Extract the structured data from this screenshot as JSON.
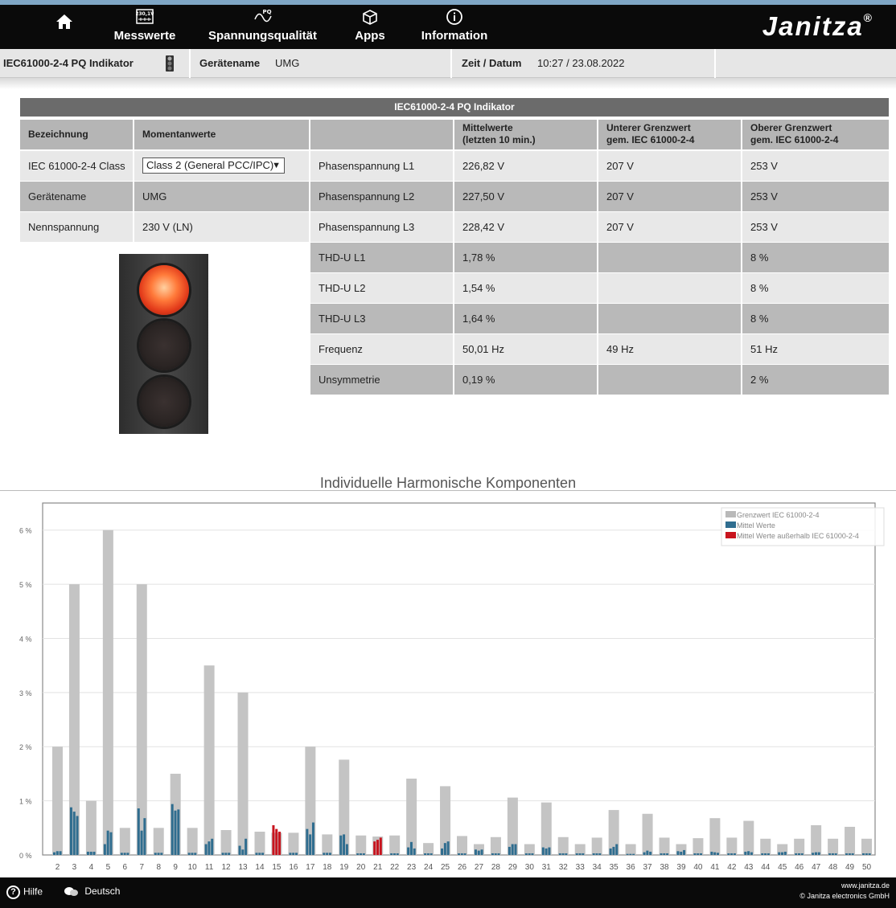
{
  "nav": {
    "home_icon": "home-icon",
    "items": [
      {
        "label": "Messwerte",
        "icon": "measurements-icon",
        "glyph": "230,1V"
      },
      {
        "label": "Spannungsqualität",
        "icon": "pq-wave-icon",
        "glyph": "PQ"
      },
      {
        "label": "Apps",
        "icon": "apps-box-icon",
        "glyph": "⬡"
      },
      {
        "label": "Information",
        "icon": "info-icon",
        "glyph": "ⓘ"
      }
    ],
    "brand": "Janitza",
    "brand_mark": "®"
  },
  "status": {
    "page": "IEC61000-2-4 PQ Indikator",
    "device_label": "Gerätename",
    "device_value": "UMG",
    "time_label": "Zeit / Datum",
    "time_value": "10:27 / 23.08.2022"
  },
  "table": {
    "title": "IEC61000-2-4 PQ Indikator",
    "headers": {
      "name": "Bezeichnung",
      "momentary": "Momentanwerte",
      "mean_1": "Mittelwerte",
      "mean_2": "(letzten 10 min.)",
      "lower_1": "Unterer Grenzwert",
      "lower_2": "gem. IEC 61000-2-4",
      "upper_1": "Oberer Grenzwert",
      "upper_2": "gem. IEC 61000-2-4"
    },
    "left_rows": [
      {
        "label": "IEC 61000-2-4 Class",
        "value": "Class 2 (General PCC/IPC)"
      },
      {
        "label": "Gerätename",
        "value": "UMG"
      },
      {
        "label": "Nennspannung",
        "value": "230 V (LN)"
      }
    ],
    "right_rows": [
      {
        "name": "Phasenspannung L1",
        "mean": "226,82 V",
        "lower": "207 V",
        "upper": "253 V"
      },
      {
        "name": "Phasenspannung L2",
        "mean": "227,50 V",
        "lower": "207 V",
        "upper": "253 V"
      },
      {
        "name": "Phasenspannung L3",
        "mean": "228,42 V",
        "lower": "207 V",
        "upper": "253 V"
      },
      {
        "name": "THD-U L1",
        "mean": "1,78 %",
        "lower": "",
        "upper": "8 %"
      },
      {
        "name": "THD-U L2",
        "mean": "1,54 %",
        "lower": "",
        "upper": "8 %"
      },
      {
        "name": "THD-U L3",
        "mean": "1,64 %",
        "lower": "",
        "upper": "8 %"
      },
      {
        "name": "Frequenz",
        "mean": "50,01 Hz",
        "lower": "49 Hz",
        "upper": "51 Hz"
      },
      {
        "name": "Unsymmetrie",
        "mean": "0,19 %",
        "lower": "",
        "upper": "2 %"
      }
    ],
    "traffic_light_state": "red"
  },
  "chart_data": {
    "type": "bar",
    "title": "Individuelle Harmonische Komponenten",
    "ylim": [
      0,
      6.5
    ],
    "yticks": [
      "0 %",
      "1 %",
      "2 %",
      "3 %",
      "4 %",
      "5 %",
      "6 %"
    ],
    "categories": [
      "2",
      "3",
      "4",
      "5",
      "6",
      "7",
      "8",
      "9",
      "10",
      "11",
      "12",
      "13",
      "14",
      "15",
      "16",
      "17",
      "18",
      "19",
      "20",
      "21",
      "22",
      "23",
      "24",
      "25",
      "26",
      "27",
      "28",
      "29",
      "30",
      "31",
      "32",
      "33",
      "34",
      "35",
      "36",
      "37",
      "38",
      "39",
      "40",
      "41",
      "42",
      "43",
      "44",
      "45",
      "46",
      "47",
      "48",
      "49",
      "50"
    ],
    "legend": [
      {
        "name": "Grenzwert IEC 61000-2-4",
        "color": "#b9b9b9"
      },
      {
        "name": "Mittel Werte",
        "color": "#2f6d8f"
      },
      {
        "name": "Mittel Werte außerhalb IEC 61000-2-4",
        "color": "#c8141e"
      }
    ],
    "legend_position": "top-right",
    "series": [
      {
        "name": "Grenzwert IEC 61000-2-4",
        "values": [
          2,
          5,
          1,
          6,
          0.5,
          5,
          0.5,
          1.5,
          0.5,
          3.5,
          0.46,
          3,
          0.43,
          0.41,
          0.41,
          2,
          0.38,
          1.76,
          0.36,
          0.34,
          0.36,
          1.41,
          0.22,
          1.27,
          0.35,
          0.2,
          0.33,
          1.06,
          0.2,
          0.97,
          0.33,
          0.2,
          0.32,
          0.83,
          0.2,
          0.76,
          0.32,
          0.2,
          0.31,
          0.68,
          0.32,
          0.63,
          0.3,
          0.2,
          0.3,
          0.55,
          0.3,
          0.52,
          0.3
        ]
      },
      {
        "name": "Mittel Werte L1",
        "values": [
          0.05,
          0.88,
          0.06,
          0.2,
          0.04,
          0.86,
          0.04,
          0.94,
          0.04,
          0.2,
          0.04,
          0.17,
          0.04,
          0.55,
          0.04,
          0.48,
          0.04,
          0.36,
          0.03,
          0.25,
          0.03,
          0.14,
          0.03,
          0.12,
          0.03,
          0.1,
          0.03,
          0.15,
          0.03,
          0.14,
          0.03,
          0.03,
          0.03,
          0.12,
          0.02,
          0.05,
          0.03,
          0.07,
          0.03,
          0.06,
          0.03,
          0.06,
          0.03,
          0.05,
          0.03,
          0.04,
          0.03,
          0.03,
          0.03
        ]
      },
      {
        "name": "Mittel Werte L2",
        "values": [
          0.07,
          0.8,
          0.06,
          0.45,
          0.04,
          0.45,
          0.04,
          0.82,
          0.04,
          0.25,
          0.04,
          0.1,
          0.04,
          0.48,
          0.04,
          0.38,
          0.04,
          0.38,
          0.03,
          0.28,
          0.03,
          0.24,
          0.03,
          0.22,
          0.03,
          0.08,
          0.03,
          0.2,
          0.03,
          0.12,
          0.03,
          0.03,
          0.03,
          0.15,
          0.02,
          0.08,
          0.03,
          0.06,
          0.03,
          0.05,
          0.03,
          0.07,
          0.03,
          0.05,
          0.03,
          0.05,
          0.03,
          0.03,
          0.03
        ]
      },
      {
        "name": "Mittel Werte L3",
        "values": [
          0.07,
          0.72,
          0.06,
          0.42,
          0.04,
          0.68,
          0.04,
          0.84,
          0.04,
          0.3,
          0.04,
          0.3,
          0.04,
          0.43,
          0.04,
          0.6,
          0.04,
          0.2,
          0.03,
          0.32,
          0.03,
          0.12,
          0.03,
          0.25,
          0.03,
          0.1,
          0.03,
          0.2,
          0.03,
          0.14,
          0.03,
          0.03,
          0.03,
          0.2,
          0.02,
          0.06,
          0.03,
          0.09,
          0.03,
          0.04,
          0.03,
          0.05,
          0.03,
          0.06,
          0.03,
          0.05,
          0.03,
          0.03,
          0.03
        ]
      }
    ],
    "out_of_limit": [
      "15",
      "21"
    ]
  },
  "footer": {
    "help": "Hilfe",
    "language": "Deutsch",
    "site": "www.janitza.de",
    "copyright": "© Janitza electronics GmbH"
  }
}
